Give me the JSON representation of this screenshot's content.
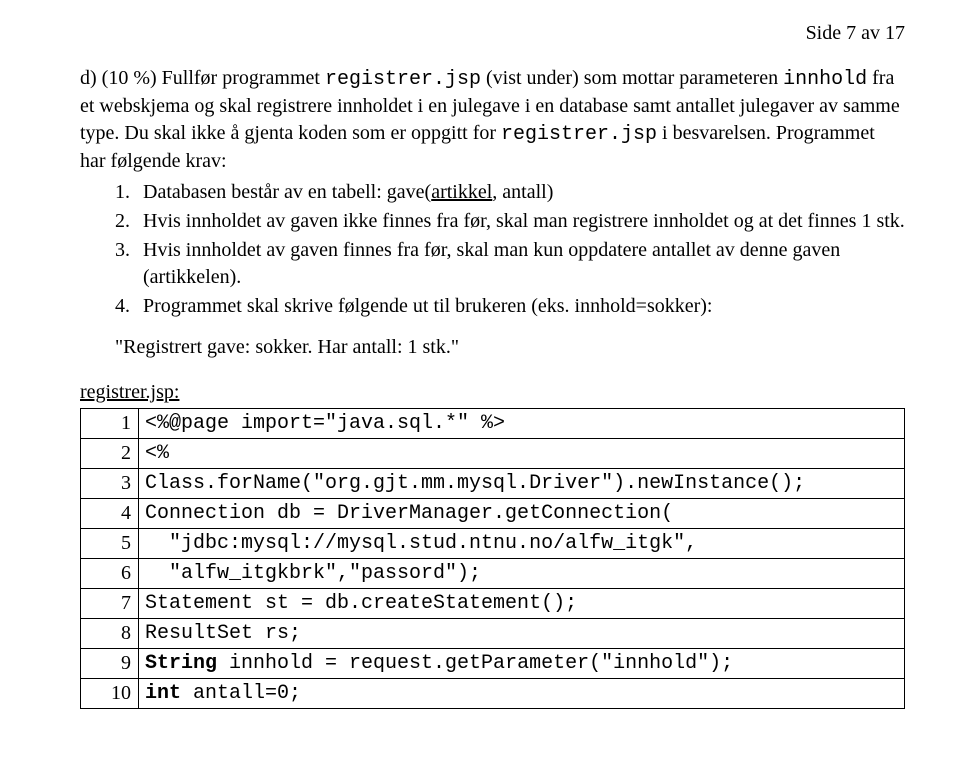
{
  "page_number_label": "Side 7 av 17",
  "problem": {
    "lead_in_1": "d) (10 %) Fullfør programmet ",
    "lead_in_code1": "registrer.jsp",
    "lead_in_2": " (vist under) som mottar parameteren ",
    "lead_in_code2": "innhold",
    "lead_in_3": " fra et webskjema og skal registrere innholdet i en julegave i en database samt antallet julegaver av samme type. Du skal ikke å gjenta koden som er oppgitt for ",
    "lead_in_code3": "registrer.jsp",
    "lead_in_4": " i besvarelsen. Programmet har følgende krav:",
    "items": [
      {
        "n": "1.",
        "pre": "Databasen består av en tabell: gave(",
        "u": "artikkel",
        "post": ", antall)"
      },
      {
        "n": "2.",
        "text": "Hvis innholdet av gaven ikke finnes fra før, skal man registrere innholdet og at det finnes 1 stk."
      },
      {
        "n": "3.",
        "text": "Hvis innholdet av gaven finnes fra før, skal man kun oppdatere antallet av denne gaven (artikkelen)."
      },
      {
        "n": "4.",
        "text": "Programmet skal skrive følgende ut til brukeren (eks. innhold=sokker):"
      }
    ],
    "quote": "\"Registrert gave: sokker. Har antall: 1 stk.\""
  },
  "code_title": "registrer.jsp:",
  "code_rows": [
    {
      "n": "1",
      "c": "<%@page import=\"java.sql.*\" %>",
      "bold": false
    },
    {
      "n": "2",
      "c": "<%",
      "bold": false
    },
    {
      "n": "3",
      "c": "Class.forName(\"org.gjt.mm.mysql.Driver\").newInstance();",
      "bold": false
    },
    {
      "n": "4",
      "c": "Connection db = DriverManager.getConnection(",
      "bold": false
    },
    {
      "n": "5",
      "c": "  \"jdbc:mysql://mysql.stud.ntnu.no/alfw_itgk\",",
      "bold": false
    },
    {
      "n": "6",
      "c": "  \"alfw_itgkbrk\",\"passord\");",
      "bold": false
    },
    {
      "n": "7",
      "c": "Statement st = db.createStatement();",
      "bold": false
    },
    {
      "n": "8",
      "c": "ResultSet rs;",
      "bold": false
    },
    {
      "n": "9",
      "c_parts": [
        {
          "t": "String",
          "b": true
        },
        {
          "t": " innhold = request.getParameter(\"innhold\");",
          "b": false
        }
      ]
    },
    {
      "n": "10",
      "c_parts": [
        {
          "t": "int",
          "b": true
        },
        {
          "t": " antall=0;",
          "b": false
        }
      ]
    }
  ]
}
